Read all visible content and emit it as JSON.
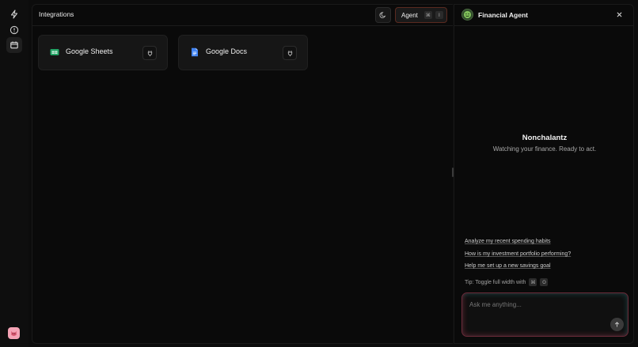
{
  "colors": {
    "background": "#0c0c0c",
    "card": "#161616",
    "accent_border": "#5a2a20",
    "sheets_green": "#23a566",
    "docs_blue": "#4285f4",
    "avatar_pink": "#f4a3b5"
  },
  "rail": {
    "items": [
      {
        "icon": "bolt-icon"
      },
      {
        "icon": "alert-circle-icon"
      },
      {
        "icon": "calendar-icon",
        "active": true
      }
    ],
    "avatar_icon": "cat-avatar-icon"
  },
  "header": {
    "title": "Integrations",
    "theme_icon": "moon-icon",
    "agent_button": {
      "label": "Agent",
      "kbd1": "⌘",
      "kbd2": "I"
    }
  },
  "integrations": [
    {
      "name": "Google Sheets",
      "icon": "google-sheets-icon",
      "action_icon": "plug-icon"
    },
    {
      "name": "Google Docs",
      "icon": "google-docs-icon",
      "action_icon": "plug-icon"
    }
  ],
  "agent_panel": {
    "title": "Financial Agent",
    "avatar_icon": "smiley-avatar-icon",
    "persona_name": "Nonchalantz",
    "persona_subtitle": "Watching your finance. Ready to act.",
    "suggestions": [
      "Analyze my recent spending habits",
      "How is my investment portfolio performing?",
      "Help me set up a new savings goal"
    ],
    "tip": {
      "text": "Tip: Toggle full width with",
      "kbd1": "⌘",
      "kbd2": "O"
    },
    "input_placeholder": "Ask me anything..."
  }
}
